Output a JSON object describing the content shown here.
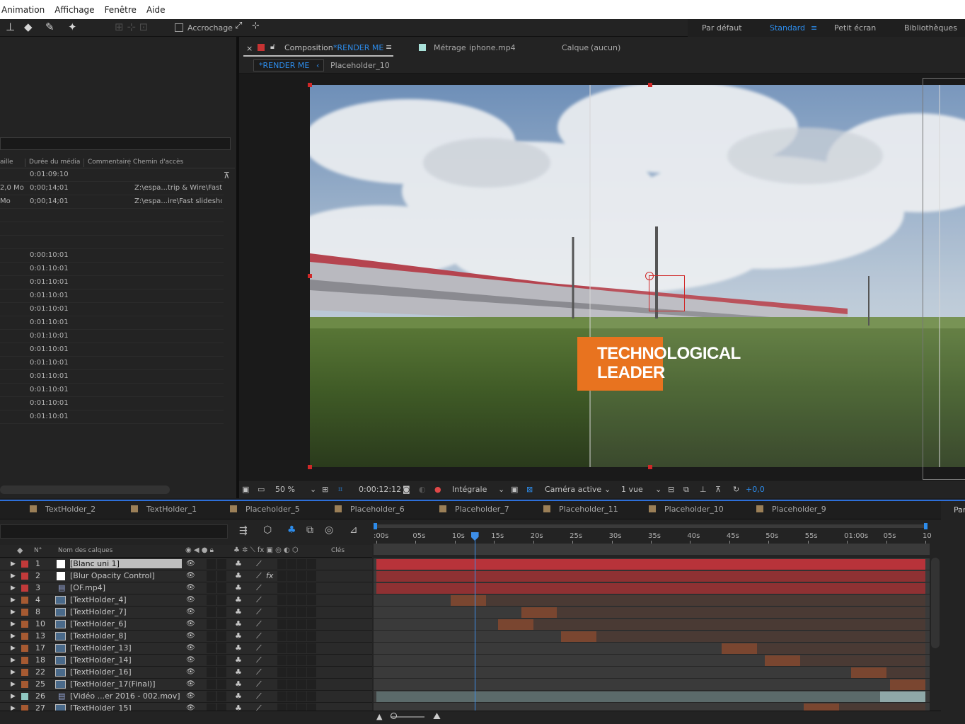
{
  "menu": {
    "items": [
      "Animation",
      "Affichage",
      "Fenêtre",
      "Aide"
    ]
  },
  "toolbar": {
    "snapping_label": "Accrochage",
    "workspaces": [
      "Par défaut",
      "Standard",
      "Petit écran",
      "Bibliothèques"
    ],
    "active_workspace": "Standard"
  },
  "project": {
    "columns": [
      "aille",
      "Durée du média",
      "Commentaire",
      "Chemin d'accès"
    ],
    "rows": [
      {
        "size": "",
        "duration": "0:01:09:10",
        "path": ""
      },
      {
        "size": "2,0 Mo",
        "duration": "0;00;14;01",
        "path": "Z:\\espa...trip & Wire\\Fast s"
      },
      {
        "size": "Mo",
        "duration": "0;00;14;01",
        "path": "Z:\\espa...ire\\Fast slidesho"
      },
      {
        "size": "",
        "duration": "",
        "path": ""
      },
      {
        "size": "",
        "duration": "",
        "path": ""
      },
      {
        "size": "",
        "duration": "",
        "path": ""
      },
      {
        "size": "",
        "duration": "0:00:10:01",
        "path": ""
      },
      {
        "size": "",
        "duration": "0:01:10:01",
        "path": ""
      },
      {
        "size": "",
        "duration": "0:01:10:01",
        "path": ""
      },
      {
        "size": "",
        "duration": "0:01:10:01",
        "path": ""
      },
      {
        "size": "",
        "duration": "0:01:10:01",
        "path": ""
      },
      {
        "size": "",
        "duration": "0:01:10:01",
        "path": ""
      },
      {
        "size": "",
        "duration": "0:01:10:01",
        "path": ""
      },
      {
        "size": "",
        "duration": "0:01:10:01",
        "path": ""
      },
      {
        "size": "",
        "duration": "0:01:10:01",
        "path": ""
      },
      {
        "size": "",
        "duration": "0:01:10:01",
        "path": ""
      },
      {
        "size": "",
        "duration": "0:01:10:01",
        "path": ""
      },
      {
        "size": "",
        "duration": "0:01:10:01",
        "path": ""
      },
      {
        "size": "",
        "duration": "0:01:10:01",
        "path": ""
      }
    ]
  },
  "composition": {
    "tab_prefix": "Composition",
    "tab_name": "*RENDER ME",
    "footage_label": "Métrage",
    "footage_name": "iphone.mp4",
    "layer_label": "Calque",
    "layer_value": "(aucun)",
    "breadcrumb_active": "*RENDER ME",
    "breadcrumb_next": "Placeholder_10",
    "overlay_line1": "TECHNOLOGICAL",
    "overlay_line2": "LEADER",
    "overlay_color": "#e8731f"
  },
  "viewer_toolbar": {
    "zoom": "50 %",
    "timecode": "0:00:12:12",
    "resolution": "Intégrale",
    "camera": "Caméra active",
    "views": "1 vue",
    "exposure": "+0,0"
  },
  "timeline": {
    "tabs": [
      "TextHolder_2",
      "TextHolder_1",
      "Placeholder_5",
      "Placeholder_6",
      "Placeholder_7",
      "Placeholder_11",
      "Placeholder_10",
      "Placeholder_9"
    ],
    "right_panel_label": "Par",
    "header": {
      "num": "N°",
      "name": "Nom des calques",
      "keys": "Clés"
    },
    "ruler": [
      ":00s",
      "05s",
      "10s",
      "15s",
      "20s",
      "25s",
      "30s",
      "35s",
      "40s",
      "45s",
      "50s",
      "55s",
      "01:00s",
      "05s",
      "10"
    ],
    "ruler_end_seconds": 70,
    "playhead_seconds": 12.5,
    "layers": [
      {
        "num": "1",
        "name": "[Blanc uni 1]",
        "color": "#c23a3a",
        "icon": "solid",
        "bar_start": 0,
        "bar_end": 70,
        "bar_color": "#b8333a",
        "selected": true,
        "fx": false
      },
      {
        "num": "2",
        "name": "[Blur Opacity Control]",
        "color": "#c23a3a",
        "icon": "solid",
        "bar_start": 0,
        "bar_end": 70,
        "bar_color": "#8f3133",
        "selected": false,
        "fx": true
      },
      {
        "num": "3",
        "name": "[OF.mp4]",
        "color": "#c23a3a",
        "icon": "file",
        "bar_start": 0,
        "bar_end": 70,
        "bar_color": "#8f3133",
        "selected": false,
        "fx": false
      },
      {
        "num": "4",
        "name": "[TextHolder_4]",
        "color": "#a65a32",
        "icon": "comp",
        "bar_start": 9.5,
        "bar_end": 70,
        "bar_color": "#4a3a34",
        "selected": false,
        "fx": false
      },
      {
        "num": "8",
        "name": "[TextHolder_7]",
        "color": "#a65a32",
        "icon": "comp",
        "bar_start": 18.5,
        "bar_end": 70,
        "bar_color": "#4a3a34",
        "selected": false,
        "fx": false
      },
      {
        "num": "10",
        "name": "[TextHolder_6]",
        "color": "#a65a32",
        "icon": "comp",
        "bar_start": 15.5,
        "bar_end": 70,
        "bar_color": "#4a3a34",
        "selected": false,
        "fx": false
      },
      {
        "num": "13",
        "name": "[TextHolder_8]",
        "color": "#a65a32",
        "icon": "comp",
        "bar_start": 23.5,
        "bar_end": 70,
        "bar_color": "#4a3a34",
        "selected": false,
        "fx": false
      },
      {
        "num": "17",
        "name": "[TextHolder_13]",
        "color": "#a65a32",
        "icon": "comp",
        "bar_start": 44,
        "bar_end": 70,
        "bar_color": "#4a3a34",
        "selected": false,
        "fx": false
      },
      {
        "num": "18",
        "name": "[TextHolder_14]",
        "color": "#a65a32",
        "icon": "comp",
        "bar_start": 49.5,
        "bar_end": 70,
        "bar_color": "#4a3a34",
        "selected": false,
        "fx": false
      },
      {
        "num": "22",
        "name": "[TextHolder_16]",
        "color": "#a65a32",
        "icon": "comp",
        "bar_start": 60.5,
        "bar_end": 70,
        "bar_color": "#4a3a34",
        "selected": false,
        "fx": false
      },
      {
        "num": "25",
        "name": "[TextHolder_17(Final)]",
        "color": "#a65a32",
        "icon": "comp",
        "bar_start": 65.5,
        "bar_end": 70,
        "bar_color": "#4a3a34",
        "selected": false,
        "fx": false
      },
      {
        "num": "26",
        "name": "[Vidéo ...er 2016 - 002.mov]",
        "color": "#8fc7c0",
        "icon": "file",
        "bar_start": 0,
        "bar_end": 70,
        "bar_color": "#5b6a6a",
        "selected": false,
        "fx": false
      },
      {
        "num": "27",
        "name": "[TextHolder_15]",
        "color": "#a65a32",
        "icon": "comp",
        "bar_start": 54.5,
        "bar_end": 70,
        "bar_color": "#4a3a34",
        "selected": false,
        "fx": false
      }
    ]
  }
}
